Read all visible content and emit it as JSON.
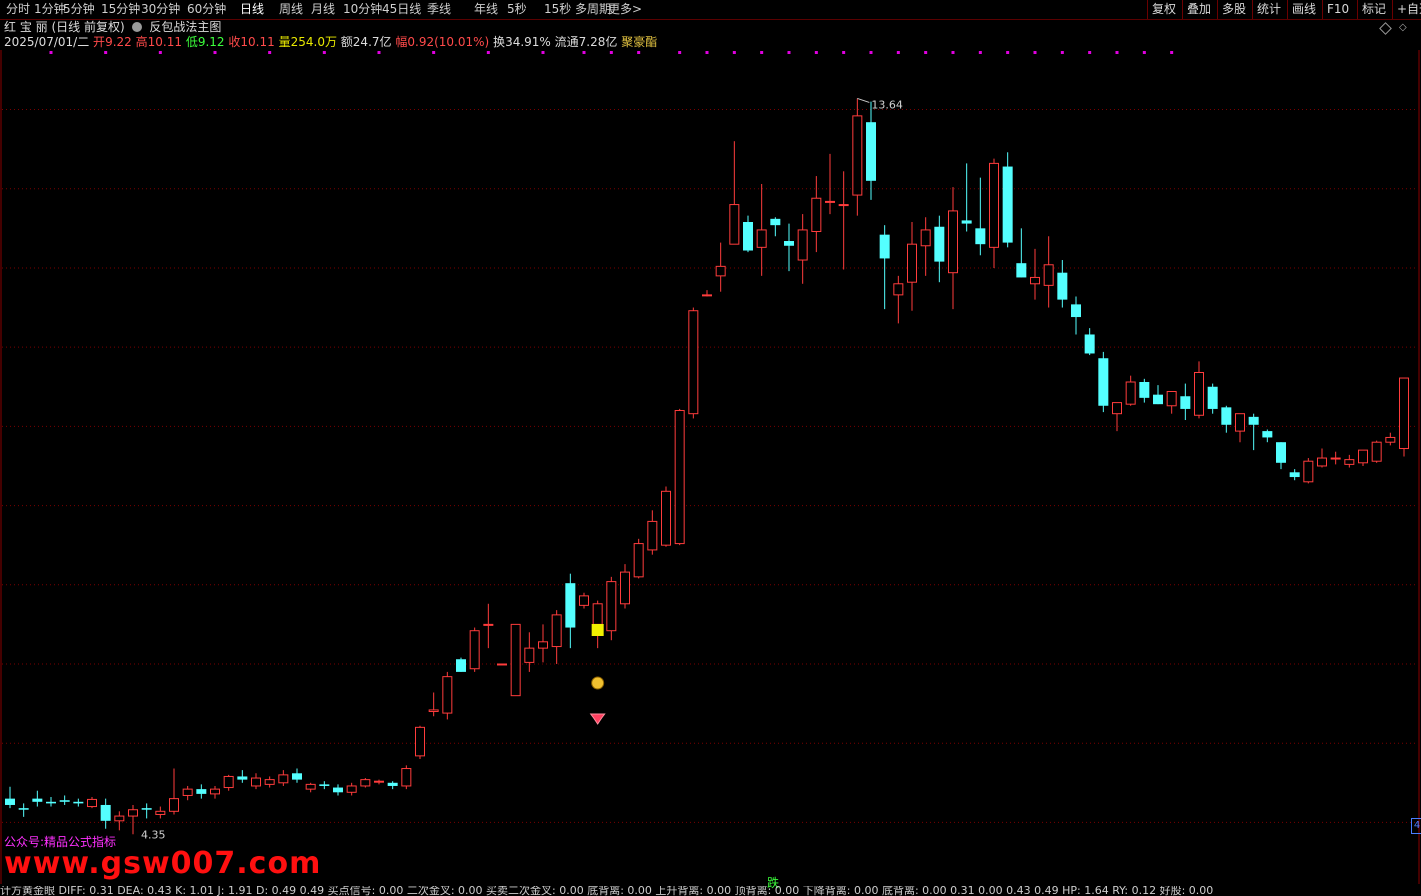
{
  "toolbar": {
    "periods": [
      "分时",
      "1分钟",
      "5分钟",
      "15分钟",
      "30分钟",
      "60分钟",
      "日线",
      "周线",
      "月线",
      "10分钟",
      "45日线",
      "季线",
      "年线",
      "5秒",
      "15秒",
      "多周期",
      "更多"
    ],
    "active_period": "日线",
    "right_buttons": [
      "复权",
      "叠加",
      "多股",
      "统计",
      "画线",
      "F10",
      "标记",
      "+自选"
    ]
  },
  "header": {
    "stock_name": "红 宝 丽",
    "period_info": "(日线 前复权)",
    "indicator_name": "反包战法主图"
  },
  "quote": {
    "date": "2025/07/01/二",
    "open_label": "开",
    "open": "9.22",
    "high_label": "高",
    "high": "10.11",
    "low_label": "低",
    "low": "9.12",
    "close_label": "收",
    "close": "10.11",
    "vol_label": "量",
    "volume": "254.0万",
    "amount_label": "额",
    "amount": "24.7亿",
    "change_label": "幅",
    "change": "0.92(10.01%)",
    "turnover_label": "换",
    "turnover": "34.91%",
    "float_label": "流通",
    "float": "7.28亿",
    "tag": "聚豪酯"
  },
  "annotations": {
    "max_label": "13.64",
    "min_label": "4.35",
    "die_label": "跌",
    "right_flag": "4",
    "promo_text": "公众号:精品公式指标",
    "watermark": "www.gsw007.com"
  },
  "bottom_indicators": "计方黄金眼  DIFF: 0.31  DEA: 0.43  K: 1.01  J: 1.91  D: 0.49  0.49  买点信号: 0.00  二次金叉: 0.00  买卖二次金叉: 0.00  底背离: 0.00  上升背离: 0.00  顶背离: 0.00  下降背离: 0.00  底背离: 0.00  0.31  0.00  0.43  0.49  HP: 1.64  RY: 0.12  好股: 0.00",
  "colors": {
    "up": "#ff3c3c",
    "down": "#54ffff",
    "grid": "#7a0000",
    "dots": "#e000e0",
    "signal": "#f0f000"
  },
  "chart_data": {
    "type": "candlestick",
    "ylim": [
      4.0,
      14.1
    ],
    "signal_dot_indices": [
      3,
      7,
      11,
      15,
      19,
      23,
      27,
      31,
      35,
      39,
      42,
      44,
      46,
      49,
      51,
      53,
      55,
      57,
      59,
      61,
      63,
      65,
      67,
      69,
      71,
      73,
      75,
      77,
      79,
      81,
      83,
      85
    ],
    "candles": [
      {
        "o": 4.8,
        "h": 4.95,
        "l": 4.68,
        "c": 4.72
      },
      {
        "o": 4.68,
        "h": 4.74,
        "l": 4.57,
        "c": 4.66
      },
      {
        "o": 4.8,
        "h": 4.9,
        "l": 4.7,
        "c": 4.76
      },
      {
        "o": 4.76,
        "h": 4.82,
        "l": 4.7,
        "c": 4.74
      },
      {
        "o": 4.78,
        "h": 4.84,
        "l": 4.72,
        "c": 4.76
      },
      {
        "o": 4.76,
        "h": 4.8,
        "l": 4.7,
        "c": 4.74
      },
      {
        "o": 4.7,
        "h": 4.82,
        "l": 4.68,
        "c": 4.79
      },
      {
        "o": 4.72,
        "h": 4.8,
        "l": 4.42,
        "c": 4.52
      },
      {
        "o": 4.52,
        "h": 4.64,
        "l": 4.4,
        "c": 4.58
      },
      {
        "o": 4.58,
        "h": 4.72,
        "l": 4.35,
        "c": 4.66
      },
      {
        "o": 4.68,
        "h": 4.74,
        "l": 4.55,
        "c": 4.66
      },
      {
        "o": 4.6,
        "h": 4.7,
        "l": 4.55,
        "c": 4.64
      },
      {
        "o": 4.64,
        "h": 5.18,
        "l": 4.6,
        "c": 4.8
      },
      {
        "o": 4.84,
        "h": 4.96,
        "l": 4.78,
        "c": 4.92
      },
      {
        "o": 4.92,
        "h": 4.98,
        "l": 4.8,
        "c": 4.86
      },
      {
        "o": 4.86,
        "h": 4.96,
        "l": 4.8,
        "c": 4.92
      },
      {
        "o": 4.94,
        "h": 5.1,
        "l": 4.9,
        "c": 5.08
      },
      {
        "o": 5.08,
        "h": 5.16,
        "l": 5.0,
        "c": 5.04
      },
      {
        "o": 4.96,
        "h": 5.12,
        "l": 4.92,
        "c": 5.06
      },
      {
        "o": 4.98,
        "h": 5.08,
        "l": 4.94,
        "c": 5.04
      },
      {
        "o": 5.0,
        "h": 5.16,
        "l": 4.96,
        "c": 5.1
      },
      {
        "o": 5.12,
        "h": 5.18,
        "l": 5.0,
        "c": 5.04
      },
      {
        "o": 4.92,
        "h": 5.0,
        "l": 4.88,
        "c": 4.98
      },
      {
        "o": 4.98,
        "h": 5.02,
        "l": 4.92,
        "c": 4.96
      },
      {
        "o": 4.94,
        "h": 4.98,
        "l": 4.84,
        "c": 4.88
      },
      {
        "o": 4.88,
        "h": 5.0,
        "l": 4.84,
        "c": 4.96
      },
      {
        "o": 4.96,
        "h": 5.06,
        "l": 4.94,
        "c": 5.04
      },
      {
        "o": 5.02,
        "h": 5.04,
        "l": 4.98,
        "c": 5.02
      },
      {
        "o": 5.0,
        "h": 5.02,
        "l": 4.92,
        "c": 4.96
      },
      {
        "o": 4.96,
        "h": 5.22,
        "l": 4.92,
        "c": 5.18
      },
      {
        "o": 5.34,
        "h": 5.72,
        "l": 5.3,
        "c": 5.7
      },
      {
        "o": 5.9,
        "h": 6.14,
        "l": 5.84,
        "c": 5.92
      },
      {
        "o": 5.88,
        "h": 6.4,
        "l": 5.8,
        "c": 6.34
      },
      {
        "o": 6.56,
        "h": 6.58,
        "l": 6.4,
        "c": 6.4
      },
      {
        "o": 6.44,
        "h": 6.96,
        "l": 6.4,
        "c": 6.92
      },
      {
        "o": 7.0,
        "h": 7.26,
        "l": 6.7,
        "c": 7.0
      },
      {
        "o": 6.5,
        "h": 6.5,
        "l": 6.5,
        "c": 6.5
      },
      {
        "o": 6.1,
        "h": 7.0,
        "l": 6.1,
        "c": 7.0
      },
      {
        "o": 6.52,
        "h": 6.9,
        "l": 6.4,
        "c": 6.7
      },
      {
        "o": 6.7,
        "h": 7.0,
        "l": 6.52,
        "c": 6.78
      },
      {
        "o": 6.72,
        "h": 7.18,
        "l": 6.5,
        "c": 7.12
      },
      {
        "o": 7.52,
        "h": 7.64,
        "l": 6.7,
        "c": 6.96
      },
      {
        "o": 7.24,
        "h": 7.4,
        "l": 7.2,
        "c": 7.36
      },
      {
        "o": 7.0,
        "h": 7.3,
        "l": 6.7,
        "c": 7.26
      },
      {
        "o": 6.92,
        "h": 7.6,
        "l": 6.8,
        "c": 7.54
      },
      {
        "o": 7.26,
        "h": 7.76,
        "l": 7.2,
        "c": 7.66
      },
      {
        "o": 7.6,
        "h": 8.08,
        "l": 7.58,
        "c": 8.02
      },
      {
        "o": 7.94,
        "h": 8.44,
        "l": 7.88,
        "c": 8.3
      },
      {
        "o": 8.0,
        "h": 8.74,
        "l": 7.98,
        "c": 8.68
      },
      {
        "o": 8.02,
        "h": 9.72,
        "l": 8.0,
        "c": 9.7
      },
      {
        "o": 9.66,
        "h": 11.0,
        "l": 9.6,
        "c": 10.96
      },
      {
        "o": 11.16,
        "h": 11.22,
        "l": 11.14,
        "c": 11.16
      },
      {
        "o": 11.4,
        "h": 11.82,
        "l": 11.2,
        "c": 11.52
      },
      {
        "o": 11.8,
        "h": 13.1,
        "l": 11.8,
        "c": 12.3
      },
      {
        "o": 12.08,
        "h": 12.16,
        "l": 11.7,
        "c": 11.72
      },
      {
        "o": 11.76,
        "h": 12.56,
        "l": 11.4,
        "c": 11.98
      },
      {
        "o": 12.12,
        "h": 12.14,
        "l": 11.9,
        "c": 12.04
      },
      {
        "o": 11.84,
        "h": 12.06,
        "l": 11.46,
        "c": 11.78
      },
      {
        "o": 11.6,
        "h": 12.18,
        "l": 11.3,
        "c": 11.98
      },
      {
        "o": 11.96,
        "h": 12.66,
        "l": 11.7,
        "c": 12.38
      },
      {
        "o": 12.34,
        "h": 12.94,
        "l": 12.18,
        "c": 12.34
      },
      {
        "o": 12.3,
        "h": 12.72,
        "l": 11.48,
        "c": 12.3
      },
      {
        "o": 12.42,
        "h": 13.64,
        "l": 12.16,
        "c": 13.42
      },
      {
        "o": 13.34,
        "h": 13.6,
        "l": 12.36,
        "c": 12.6
      },
      {
        "o": 11.92,
        "h": 12.04,
        "l": 10.98,
        "c": 11.62
      },
      {
        "o": 11.16,
        "h": 11.4,
        "l": 10.8,
        "c": 11.3
      },
      {
        "o": 11.32,
        "h": 12.08,
        "l": 10.96,
        "c": 11.8
      },
      {
        "o": 11.78,
        "h": 12.14,
        "l": 11.4,
        "c": 11.98
      },
      {
        "o": 12.02,
        "h": 12.16,
        "l": 11.32,
        "c": 11.58
      },
      {
        "o": 11.44,
        "h": 12.52,
        "l": 10.98,
        "c": 12.22
      },
      {
        "o": 12.1,
        "h": 12.82,
        "l": 11.96,
        "c": 12.06
      },
      {
        "o": 12.0,
        "h": 12.64,
        "l": 11.66,
        "c": 11.8
      },
      {
        "o": 11.76,
        "h": 12.88,
        "l": 11.5,
        "c": 12.82
      },
      {
        "o": 12.78,
        "h": 12.96,
        "l": 11.76,
        "c": 11.82
      },
      {
        "o": 11.56,
        "h": 12.0,
        "l": 11.46,
        "c": 11.38
      },
      {
        "o": 11.3,
        "h": 11.74,
        "l": 11.1,
        "c": 11.38
      },
      {
        "o": 11.28,
        "h": 11.9,
        "l": 11.0,
        "c": 11.54
      },
      {
        "o": 11.44,
        "h": 11.6,
        "l": 11.0,
        "c": 11.1
      },
      {
        "o": 11.04,
        "h": 11.14,
        "l": 10.66,
        "c": 10.88
      },
      {
        "o": 10.66,
        "h": 10.74,
        "l": 10.4,
        "c": 10.42
      },
      {
        "o": 10.36,
        "h": 10.44,
        "l": 9.68,
        "c": 9.76
      },
      {
        "o": 9.66,
        "h": 9.8,
        "l": 9.44,
        "c": 9.8
      },
      {
        "o": 9.78,
        "h": 10.14,
        "l": 9.76,
        "c": 10.06
      },
      {
        "o": 10.06,
        "h": 10.1,
        "l": 9.8,
        "c": 9.86
      },
      {
        "o": 9.9,
        "h": 10.02,
        "l": 9.78,
        "c": 9.78
      },
      {
        "o": 9.76,
        "h": 9.94,
        "l": 9.66,
        "c": 9.94
      },
      {
        "o": 9.88,
        "h": 10.04,
        "l": 9.58,
        "c": 9.72
      },
      {
        "o": 9.64,
        "h": 10.32,
        "l": 9.6,
        "c": 10.18
      },
      {
        "o": 10.0,
        "h": 10.04,
        "l": 9.66,
        "c": 9.72
      },
      {
        "o": 9.74,
        "h": 9.76,
        "l": 9.42,
        "c": 9.52
      },
      {
        "o": 9.44,
        "h": 9.66,
        "l": 9.3,
        "c": 9.66
      },
      {
        "o": 9.62,
        "h": 9.66,
        "l": 9.2,
        "c": 9.52
      },
      {
        "o": 9.44,
        "h": 9.46,
        "l": 9.3,
        "c": 9.36
      },
      {
        "o": 9.3,
        "h": 9.2,
        "l": 8.96,
        "c": 9.04
      },
      {
        "o": 8.92,
        "h": 8.96,
        "l": 8.82,
        "c": 8.86
      },
      {
        "o": 8.8,
        "h": 9.1,
        "l": 8.78,
        "c": 9.06
      },
      {
        "o": 9.0,
        "h": 9.22,
        "l": 8.98,
        "c": 9.1
      },
      {
        "o": 9.1,
        "h": 9.18,
        "l": 9.02,
        "c": 9.1
      },
      {
        "o": 9.02,
        "h": 9.14,
        "l": 8.98,
        "c": 9.08
      },
      {
        "o": 9.04,
        "h": 9.2,
        "l": 9.0,
        "c": 9.2
      },
      {
        "o": 9.06,
        "h": 9.32,
        "l": 9.04,
        "c": 9.3
      },
      {
        "o": 9.3,
        "h": 9.42,
        "l": 9.26,
        "c": 9.36
      },
      {
        "o": 9.22,
        "h": 10.11,
        "l": 9.12,
        "c": 10.11
      }
    ]
  }
}
